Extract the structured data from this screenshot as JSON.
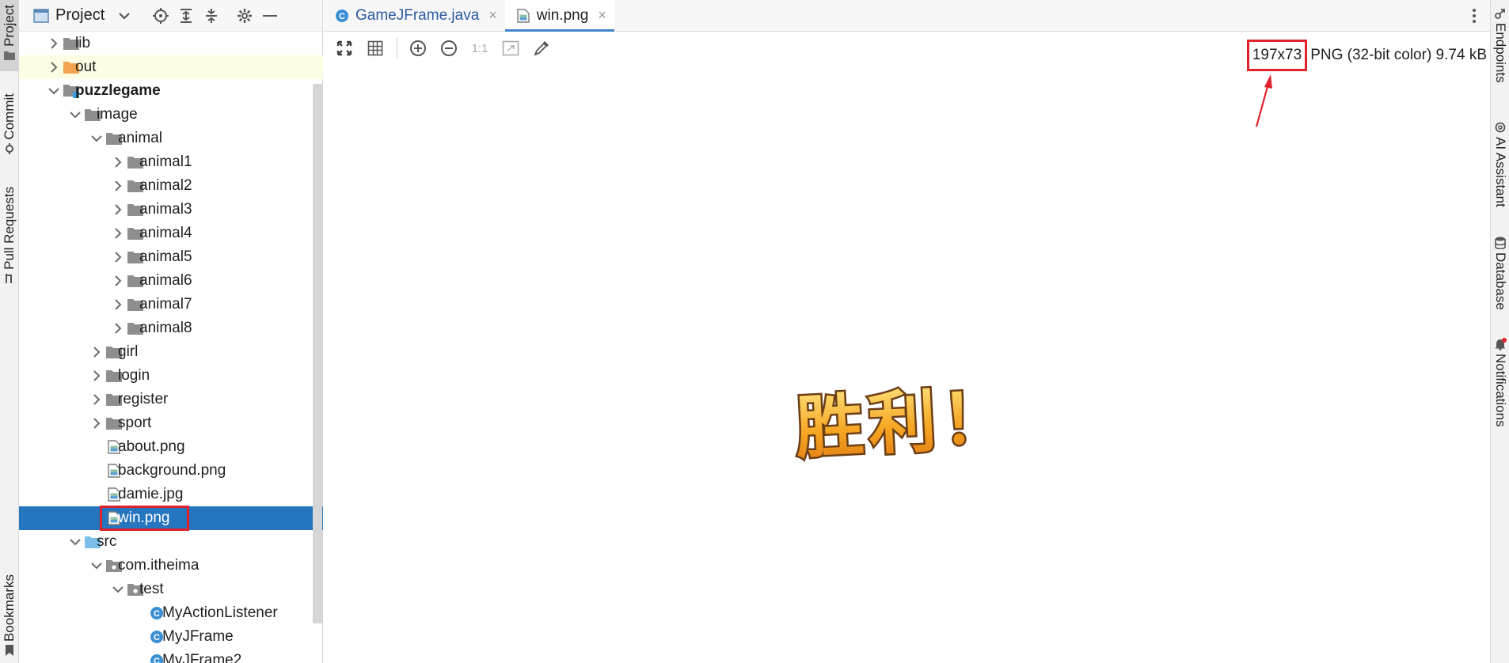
{
  "left_strip": {
    "tabs": [
      {
        "label": "Project",
        "icon": "folder-icon"
      },
      {
        "label": "Commit",
        "icon": "commit-icon"
      },
      {
        "label": "Pull Requests",
        "icon": "pull-request-icon"
      },
      {
        "label": "Bookmarks",
        "icon": "bookmark-icon"
      }
    ]
  },
  "right_strip": {
    "tabs": [
      {
        "label": "Endpoints",
        "icon": "endpoints-icon"
      },
      {
        "label": "AI Assistant",
        "icon": "ai-assistant-icon"
      },
      {
        "label": "Database",
        "icon": "database-icon"
      },
      {
        "label": "Notifications",
        "icon": "bell-icon"
      }
    ]
  },
  "project_panel": {
    "title": "Project",
    "tree": [
      {
        "label": "lib",
        "depth": 1,
        "chevron": "right",
        "icon": "folder"
      },
      {
        "label": "out",
        "depth": 1,
        "chevron": "right",
        "icon": "folder-orange",
        "highlight": true
      },
      {
        "label": "puzzlegame",
        "depth": 1,
        "chevron": "down",
        "icon": "module",
        "bold": true
      },
      {
        "label": "image",
        "depth": 2,
        "chevron": "down",
        "icon": "folder"
      },
      {
        "label": "animal",
        "depth": 3,
        "chevron": "down",
        "icon": "folder"
      },
      {
        "label": "animal1",
        "depth": 4,
        "chevron": "right",
        "icon": "folder"
      },
      {
        "label": "animal2",
        "depth": 4,
        "chevron": "right",
        "icon": "folder"
      },
      {
        "label": "animal3",
        "depth": 4,
        "chevron": "right",
        "icon": "folder"
      },
      {
        "label": "animal4",
        "depth": 4,
        "chevron": "right",
        "icon": "folder"
      },
      {
        "label": "animal5",
        "depth": 4,
        "chevron": "right",
        "icon": "folder"
      },
      {
        "label": "animal6",
        "depth": 4,
        "chevron": "right",
        "icon": "folder"
      },
      {
        "label": "animal7",
        "depth": 4,
        "chevron": "right",
        "icon": "folder"
      },
      {
        "label": "animal8",
        "depth": 4,
        "chevron": "right",
        "icon": "folder"
      },
      {
        "label": "girl",
        "depth": 3,
        "chevron": "right",
        "icon": "folder"
      },
      {
        "label": "login",
        "depth": 3,
        "chevron": "right",
        "icon": "folder"
      },
      {
        "label": "register",
        "depth": 3,
        "chevron": "right",
        "icon": "folder"
      },
      {
        "label": "sport",
        "depth": 3,
        "chevron": "right",
        "icon": "folder"
      },
      {
        "label": "about.png",
        "depth": 3,
        "chevron": "none",
        "icon": "image-file"
      },
      {
        "label": "background.png",
        "depth": 3,
        "chevron": "none",
        "icon": "image-file"
      },
      {
        "label": "damie.jpg",
        "depth": 3,
        "chevron": "none",
        "icon": "image-file"
      },
      {
        "label": "win.png",
        "depth": 3,
        "chevron": "none",
        "icon": "image-file",
        "selected": true,
        "boxed": true
      },
      {
        "label": "src",
        "depth": 2,
        "chevron": "down",
        "icon": "folder-blue"
      },
      {
        "label": "com.itheima",
        "depth": 3,
        "chevron": "down",
        "icon": "package"
      },
      {
        "label": "test",
        "depth": 4,
        "chevron": "down",
        "icon": "package"
      },
      {
        "label": "MyActionListener",
        "depth": 5,
        "chevron": "none",
        "icon": "class"
      },
      {
        "label": "MyJFrame",
        "depth": 5,
        "chevron": "none",
        "icon": "class"
      },
      {
        "label": "MyJFrame2",
        "depth": 5,
        "chevron": "none",
        "icon": "class"
      }
    ]
  },
  "tabs": [
    {
      "label": "GameJFrame.java",
      "icon": "java-class-icon",
      "close": "×",
      "active": false
    },
    {
      "label": "win.png",
      "icon": "image-file-icon",
      "close": "×",
      "active": true
    }
  ],
  "viewer": {
    "toolbar": [
      {
        "name": "fit-zoom-button",
        "icon": "fit-zoom-icon"
      },
      {
        "name": "grid-toggle-button",
        "icon": "grid-icon"
      },
      {
        "name": "zoom-in-button",
        "icon": "zoom-in-icon"
      },
      {
        "name": "zoom-out-button",
        "icon": "zoom-out-icon"
      },
      {
        "name": "actual-size-button",
        "icon": "actual-size-icon",
        "label": "1:1"
      },
      {
        "name": "fit-window-button",
        "icon": "fit-window-icon"
      },
      {
        "name": "color-picker-button",
        "icon": "eyedropper-icon"
      }
    ],
    "info": {
      "dimensions": "197x73",
      "details": "PNG (32-bit color) 9.74 kB"
    },
    "image_text": "胜利！",
    "colors": {
      "annotation_red": "#e1222b",
      "selection_blue": "#2675bf",
      "image_orange": "#f4a020",
      "image_outline": "#6b3e16"
    }
  }
}
